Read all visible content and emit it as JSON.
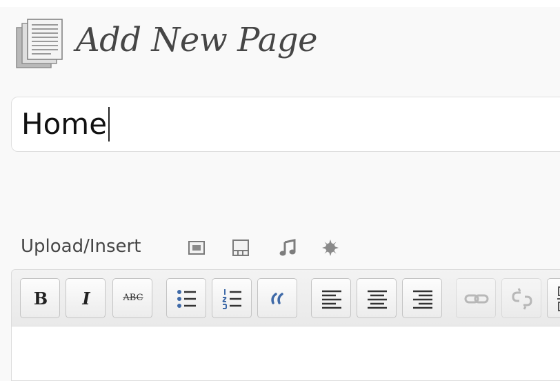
{
  "header": {
    "title": "Add New Page",
    "icon": "pages-icon"
  },
  "title_field": {
    "value": "Home"
  },
  "media": {
    "label": "Upload/Insert",
    "buttons": [
      "add-image-icon",
      "add-video-icon",
      "add-audio-icon",
      "add-media-icon"
    ]
  },
  "toolbar": {
    "bold": "B",
    "italic": "I",
    "strikethrough": "ABC",
    "buttons": [
      "bold-button",
      "italic-button",
      "strikethrough-button",
      "bullet-list-button",
      "numbered-list-button",
      "blockquote-button",
      "align-left-button",
      "align-center-button",
      "align-right-button",
      "insert-link-button",
      "unlink-button",
      "more-button"
    ]
  },
  "colors": {
    "title_text": "#464646",
    "toolbar_bg": "#ececec",
    "border": "#dfdfdf",
    "list_blue": "#3f6aa8"
  }
}
